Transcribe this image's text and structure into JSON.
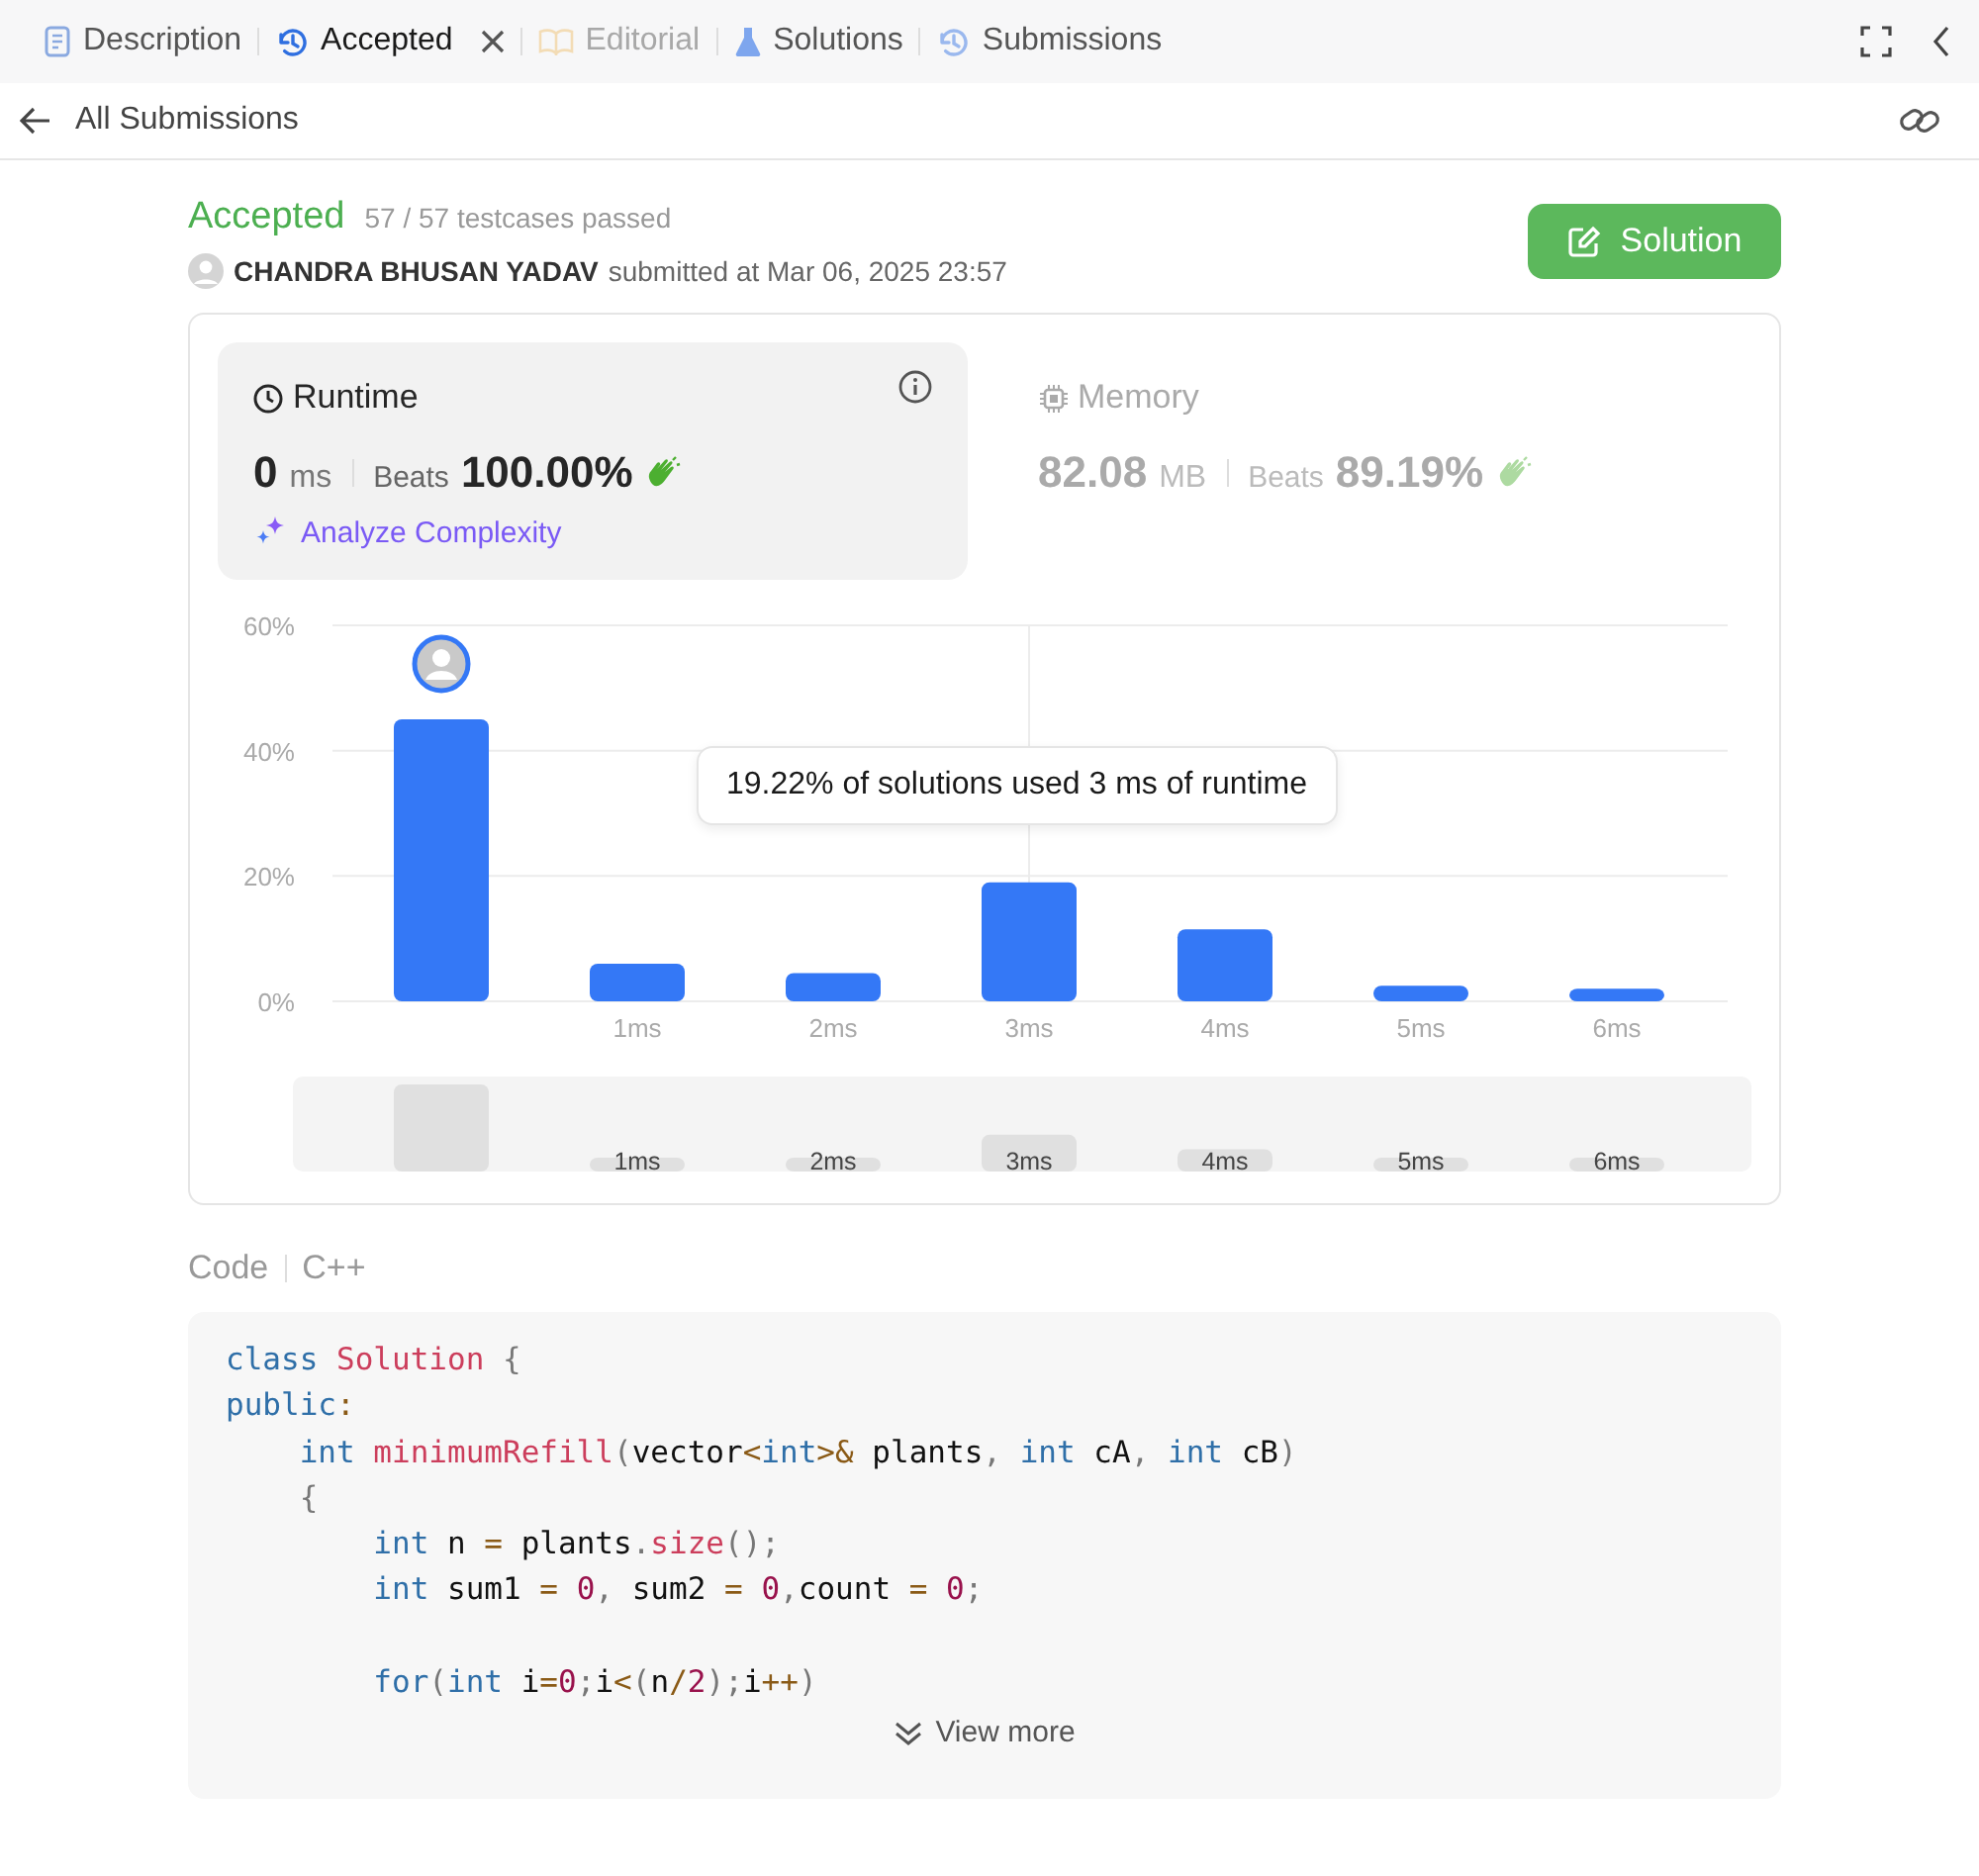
{
  "tabs": [
    {
      "label": "Description",
      "selected": false,
      "disabled": false,
      "closable": false
    },
    {
      "label": "Accepted",
      "selected": true,
      "disabled": false,
      "closable": true
    },
    {
      "label": "Editorial",
      "selected": false,
      "disabled": true,
      "closable": false
    },
    {
      "label": "Solutions",
      "selected": false,
      "disabled": false,
      "closable": false
    },
    {
      "label": "Submissions",
      "selected": false,
      "disabled": false,
      "closable": false
    }
  ],
  "nav": {
    "back_label": "All Submissions"
  },
  "result": {
    "status": "Accepted",
    "testcases": "57 / 57 testcases passed",
    "author": "CHANDRA BHUSAN YADAV",
    "submitted": "submitted at Mar 06, 2025 23:57",
    "solution_button": "Solution"
  },
  "stats": [
    {
      "title": "Runtime",
      "value": "0",
      "unit": "ms",
      "beats_label": "Beats",
      "beats": "100.00%",
      "selected": true,
      "info": true,
      "action": "Analyze Complexity"
    },
    {
      "title": "Memory",
      "value": "82.08",
      "unit": "MB",
      "beats_label": "Beats",
      "beats": "89.19%",
      "selected": false,
      "info": false
    }
  ],
  "chart": {
    "chart_data": {
      "type": "bar",
      "categories": [
        null,
        "1ms",
        "2ms",
        "3ms",
        "4ms",
        "5ms",
        "6ms"
      ],
      "series": [
        {
          "color": "#3478f6",
          "values": [
            45,
            6,
            4.5,
            19,
            11.5,
            2.5,
            2
          ]
        }
      ],
      "ylim": [
        0,
        60
      ],
      "yticks": [
        {
          "value": 0,
          "label": "0%"
        },
        {
          "value": 20,
          "label": "20%"
        },
        {
          "value": 40,
          "label": "40%"
        },
        {
          "value": 60,
          "label": "60%"
        }
      ],
      "grid": true,
      "annotations": [
        "19.22% of solutions used 3 ms of runtime"
      ]
    },
    "navigator_labels": [
      "1ms",
      "2ms",
      "3ms",
      "4ms",
      "5ms",
      "6ms"
    ]
  },
  "code": {
    "label": "Code",
    "language": "C++",
    "view_more": "View more",
    "lines": [
      {
        "kind": "code",
        "tokens": [
          {
            "t": "class",
            "color": "#2f6fa8"
          },
          {
            "t": " Solution",
            "color": "#cc3e5c"
          },
          {
            "t": " {",
            "color": "#777777"
          }
        ]
      },
      {
        "kind": "code",
        "tokens": [
          {
            "t": "public",
            "color": "#2f6fa8"
          },
          {
            "t": ":",
            "color": "#8a5a16"
          }
        ]
      },
      {
        "kind": "code",
        "tokens": [
          {
            "t": "    int",
            "color": "#2f6fa8"
          },
          {
            "t": " minimumRefill",
            "color": "#cc3e5c"
          },
          {
            "t": "(",
            "color": "#777777"
          },
          {
            "t": "vector",
            "color": "#111111"
          },
          {
            "t": "<",
            "color": "#8a5a16"
          },
          {
            "t": "int",
            "color": "#2f6fa8"
          },
          {
            "t": ">&",
            "color": "#8a5a16"
          },
          {
            "t": " plants",
            "color": "#111111"
          },
          {
            "t": ", ",
            "color": "#777777"
          },
          {
            "t": "int",
            "color": "#2f6fa8"
          },
          {
            "t": " cA",
            "color": "#111111"
          },
          {
            "t": ", ",
            "color": "#777777"
          },
          {
            "t": "int",
            "color": "#2f6fa8"
          },
          {
            "t": " cB",
            "color": "#111111"
          },
          {
            "t": ")",
            "color": "#777777"
          }
        ]
      },
      {
        "kind": "code",
        "tokens": [
          {
            "t": "    {",
            "color": "#777777"
          }
        ]
      },
      {
        "kind": "code",
        "tokens": [
          {
            "t": "        int",
            "color": "#2f6fa8"
          },
          {
            "t": " n ",
            "color": "#111111"
          },
          {
            "t": "=",
            "color": "#8a5a16"
          },
          {
            "t": " plants",
            "color": "#111111"
          },
          {
            "t": ".",
            "color": "#777777"
          },
          {
            "t": "size",
            "color": "#cc3e5c"
          },
          {
            "t": "();",
            "color": "#777777"
          }
        ]
      },
      {
        "kind": "code",
        "tokens": [
          {
            "t": "        int",
            "color": "#2f6fa8"
          },
          {
            "t": " sum1 ",
            "color": "#111111"
          },
          {
            "t": "=",
            "color": "#8a5a16"
          },
          {
            "t": " 0",
            "color": "#99124c"
          },
          {
            "t": ",",
            "color": "#777777"
          },
          {
            "t": " sum2 ",
            "color": "#111111"
          },
          {
            "t": "=",
            "color": "#8a5a16"
          },
          {
            "t": " 0",
            "color": "#99124c"
          },
          {
            "t": ",",
            "color": "#777777"
          },
          {
            "t": "count ",
            "color": "#111111"
          },
          {
            "t": "=",
            "color": "#8a5a16"
          },
          {
            "t": " 0",
            "color": "#99124c"
          },
          {
            "t": ";",
            "color": "#777777"
          }
        ]
      },
      {
        "kind": "blank"
      },
      {
        "kind": "code",
        "tokens": [
          {
            "t": "        for",
            "color": "#2f6fa8"
          },
          {
            "t": "(",
            "color": "#777777"
          },
          {
            "t": "int",
            "color": "#2f6fa8"
          },
          {
            "t": " i",
            "color": "#111111"
          },
          {
            "t": "=",
            "color": "#8a5a16"
          },
          {
            "t": "0",
            "color": "#99124c"
          },
          {
            "t": ";",
            "color": "#777777"
          },
          {
            "t": "i",
            "color": "#111111"
          },
          {
            "t": "<",
            "color": "#8a5a16"
          },
          {
            "t": "(",
            "color": "#777777"
          },
          {
            "t": "n",
            "color": "#111111"
          },
          {
            "t": "/",
            "color": "#8a5a16"
          },
          {
            "t": "2",
            "color": "#99124c"
          },
          {
            "t": ");",
            "color": "#777777"
          },
          {
            "t": "i",
            "color": "#111111"
          },
          {
            "t": "++",
            "color": "#8a5a16"
          },
          {
            "t": ")",
            "color": "#777777"
          }
        ]
      }
    ]
  }
}
